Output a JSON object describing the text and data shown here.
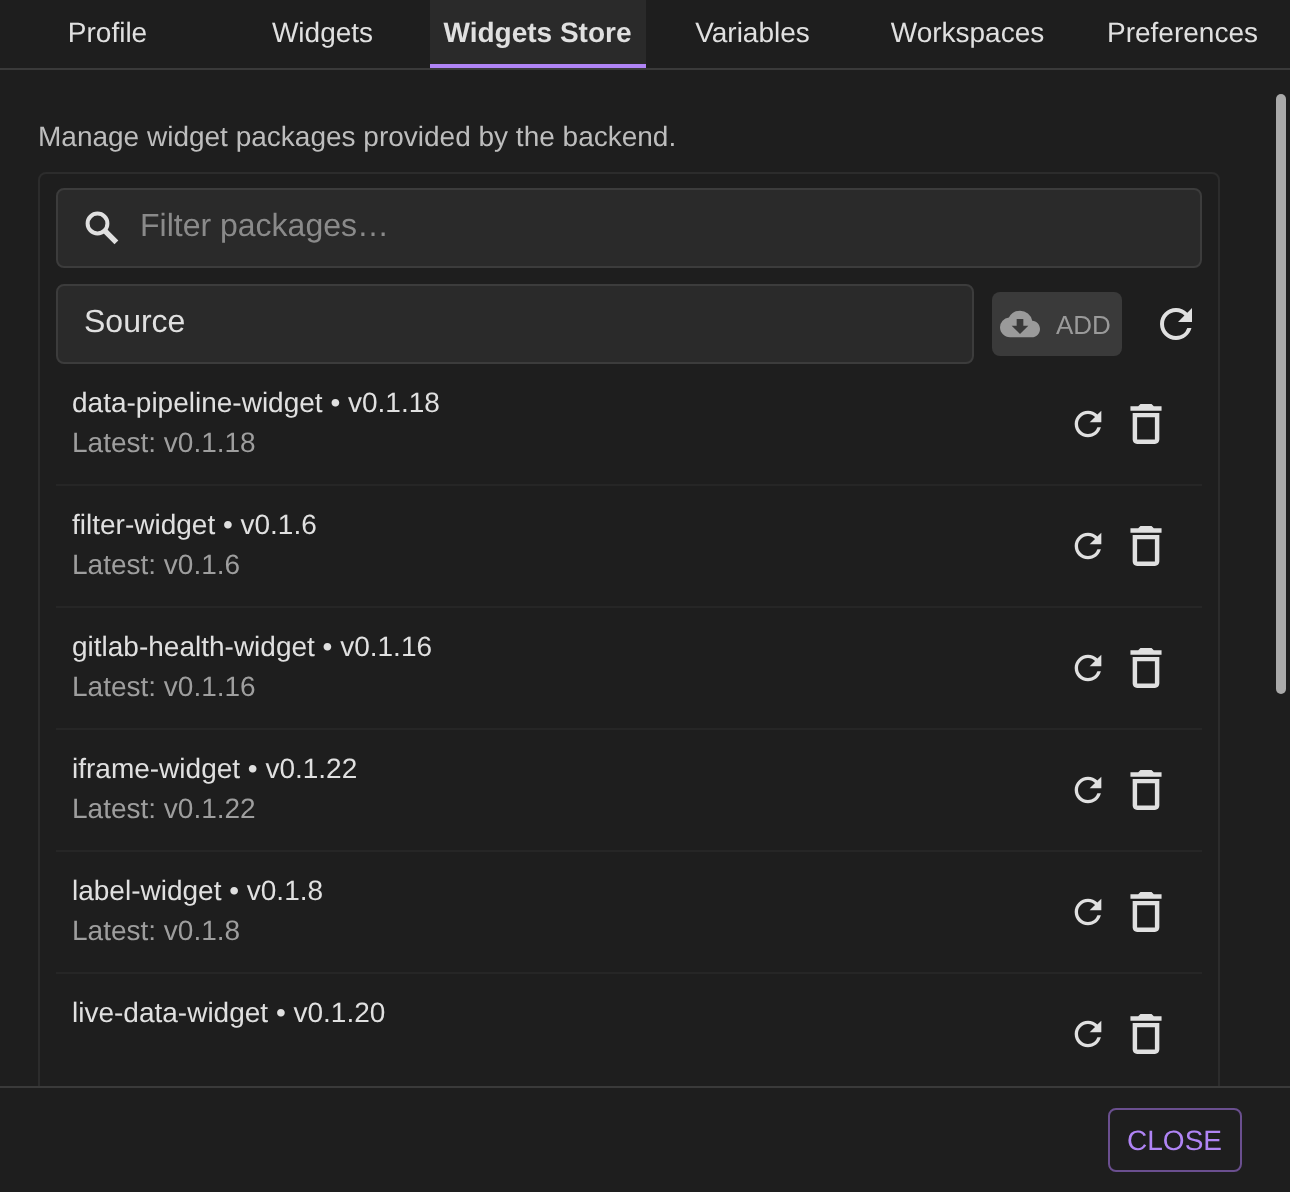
{
  "tabs": [
    {
      "label": "Profile",
      "selected": false
    },
    {
      "label": "Widgets",
      "selected": false
    },
    {
      "label": "Widgets Store",
      "selected": true
    },
    {
      "label": "Variables",
      "selected": false
    },
    {
      "label": "Workspaces",
      "selected": false
    },
    {
      "label": "Preferences",
      "selected": false
    }
  ],
  "description": "Manage widget packages provided by the backend.",
  "filter": {
    "placeholder": "Filter packages…"
  },
  "source": {
    "placeholder": "Source"
  },
  "add_button": {
    "label": "ADD",
    "disabled": true
  },
  "packages": [
    {
      "title": "data-pipeline-widget • v0.1.18",
      "latest": "Latest: v0.1.18"
    },
    {
      "title": "filter-widget • v0.1.6",
      "latest": "Latest: v0.1.6"
    },
    {
      "title": "gitlab-health-widget • v0.1.16",
      "latest": "Latest: v0.1.16"
    },
    {
      "title": "iframe-widget • v0.1.22",
      "latest": "Latest: v0.1.22"
    },
    {
      "title": "label-widget • v0.1.8",
      "latest": "Latest: v0.1.8"
    },
    {
      "title": "live-data-widget • v0.1.20"
    }
  ],
  "close_button": {
    "label": "CLOSE"
  }
}
